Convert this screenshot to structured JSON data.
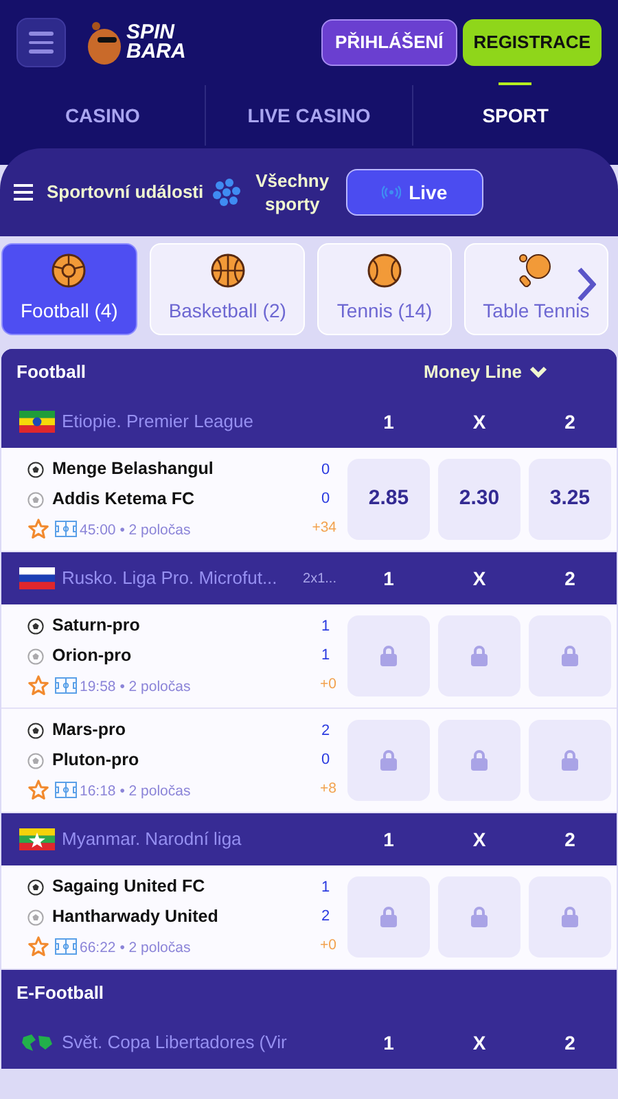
{
  "header": {
    "logo_text": [
      "SPIN",
      "BARA"
    ],
    "login": "PŘIHLÁŠENÍ",
    "register": "REGISTRACE"
  },
  "nav": [
    {
      "label": "CASINO",
      "selected": false
    },
    {
      "label": "LIVE CASINO",
      "selected": false
    },
    {
      "label": "SPORT",
      "selected": true
    }
  ],
  "toolbar": {
    "events": "Sportovní události",
    "all_sports": [
      "Všechny",
      "sporty"
    ],
    "live": "Live"
  },
  "sport_tabs": [
    {
      "label": "Football (4)",
      "kind": "football",
      "selected": true
    },
    {
      "label": "Basketball (2)",
      "kind": "basketball",
      "selected": false
    },
    {
      "label": "Tennis (14)",
      "kind": "tennis",
      "selected": false
    },
    {
      "label": "Table Tennis",
      "kind": "table-tennis",
      "selected": false
    }
  ],
  "sections": [
    {
      "title": "Football",
      "market": "Money Line",
      "leagues": [
        {
          "name": "Etiopie. Premier League",
          "kind": "ethiopia",
          "outcomes": [
            "1",
            "X",
            "2"
          ],
          "matches": [
            {
              "home": "Menge Belashangul",
              "away": "Addis Ketema FC",
              "home_score": "0",
              "away_score": "0",
              "time": "45:00 • 2 poločas",
              "more": "+34",
              "locked": false,
              "odds": [
                "2.85",
                "2.30",
                "3.25"
              ]
            }
          ]
        },
        {
          "name": "Rusko. Liga Pro. Microfut...",
          "extra": "2x1...",
          "kind": "russia",
          "outcomes": [
            "1",
            "X",
            "2"
          ],
          "matches": [
            {
              "home": "Saturn-pro",
              "away": "Orion-pro",
              "home_score": "1",
              "away_score": "1",
              "time": "19:58 • 2 poločas",
              "more": "+0",
              "locked": true
            },
            {
              "home": "Mars-pro",
              "away": "Pluton-pro",
              "home_score": "2",
              "away_score": "0",
              "time": "16:18 • 2 poločas",
              "more": "+8",
              "locked": true
            }
          ]
        },
        {
          "name": "Myanmar. Narodní liga",
          "kind": "myanmar",
          "outcomes": [
            "1",
            "X",
            "2"
          ],
          "matches": [
            {
              "home": "Sagaing United FC",
              "away": "Hantharwady United",
              "home_score": "1",
              "away_score": "2",
              "time": "66:22 • 2 poločas",
              "more": "+0",
              "locked": true
            }
          ]
        }
      ]
    },
    {
      "title": "E-Football",
      "leagues": [
        {
          "name": "Svět. Copa Libertadores (Vir",
          "kind": "world",
          "outcomes": [
            "1",
            "X",
            "2"
          ]
        }
      ]
    }
  ]
}
